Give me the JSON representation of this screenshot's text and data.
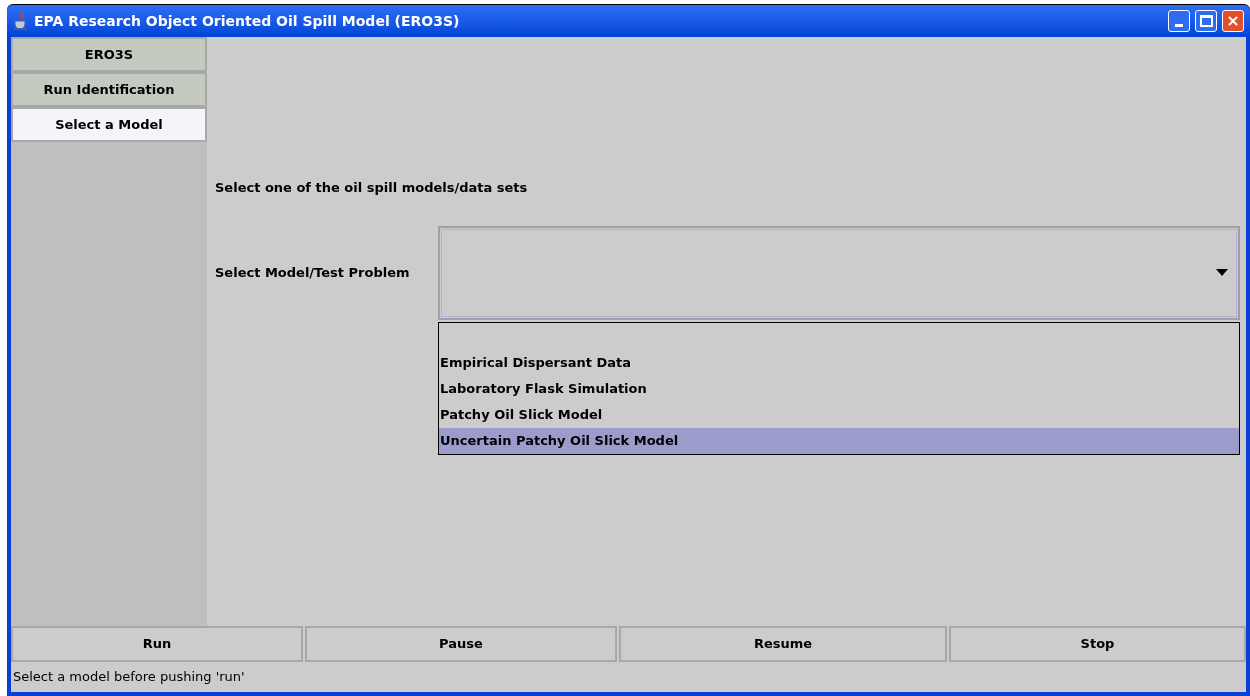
{
  "window": {
    "title": "EPA Research Object Oriented Oil Spill Model (ERO3S)"
  },
  "sidebar": {
    "items": [
      {
        "label": "ERO3S",
        "selected": false
      },
      {
        "label": "Run Identification",
        "selected": false
      },
      {
        "label": "Select a Model",
        "selected": true
      }
    ]
  },
  "panel": {
    "instruction": "Select one of the oil spill models/data sets",
    "combo_label": "Select Model/Test Problem",
    "options": [
      {
        "label": "Empirical Dispersant Data",
        "selected": false
      },
      {
        "label": "Laboratory Flask Simulation",
        "selected": false
      },
      {
        "label": "Patchy Oil Slick Model",
        "selected": false
      },
      {
        "label": "Uncertain Patchy Oil Slick Model",
        "selected": true
      }
    ]
  },
  "buttons": [
    "Run",
    "Pause",
    "Resume",
    "Stop"
  ],
  "status_bar": "Select a model before pushing 'run'"
}
